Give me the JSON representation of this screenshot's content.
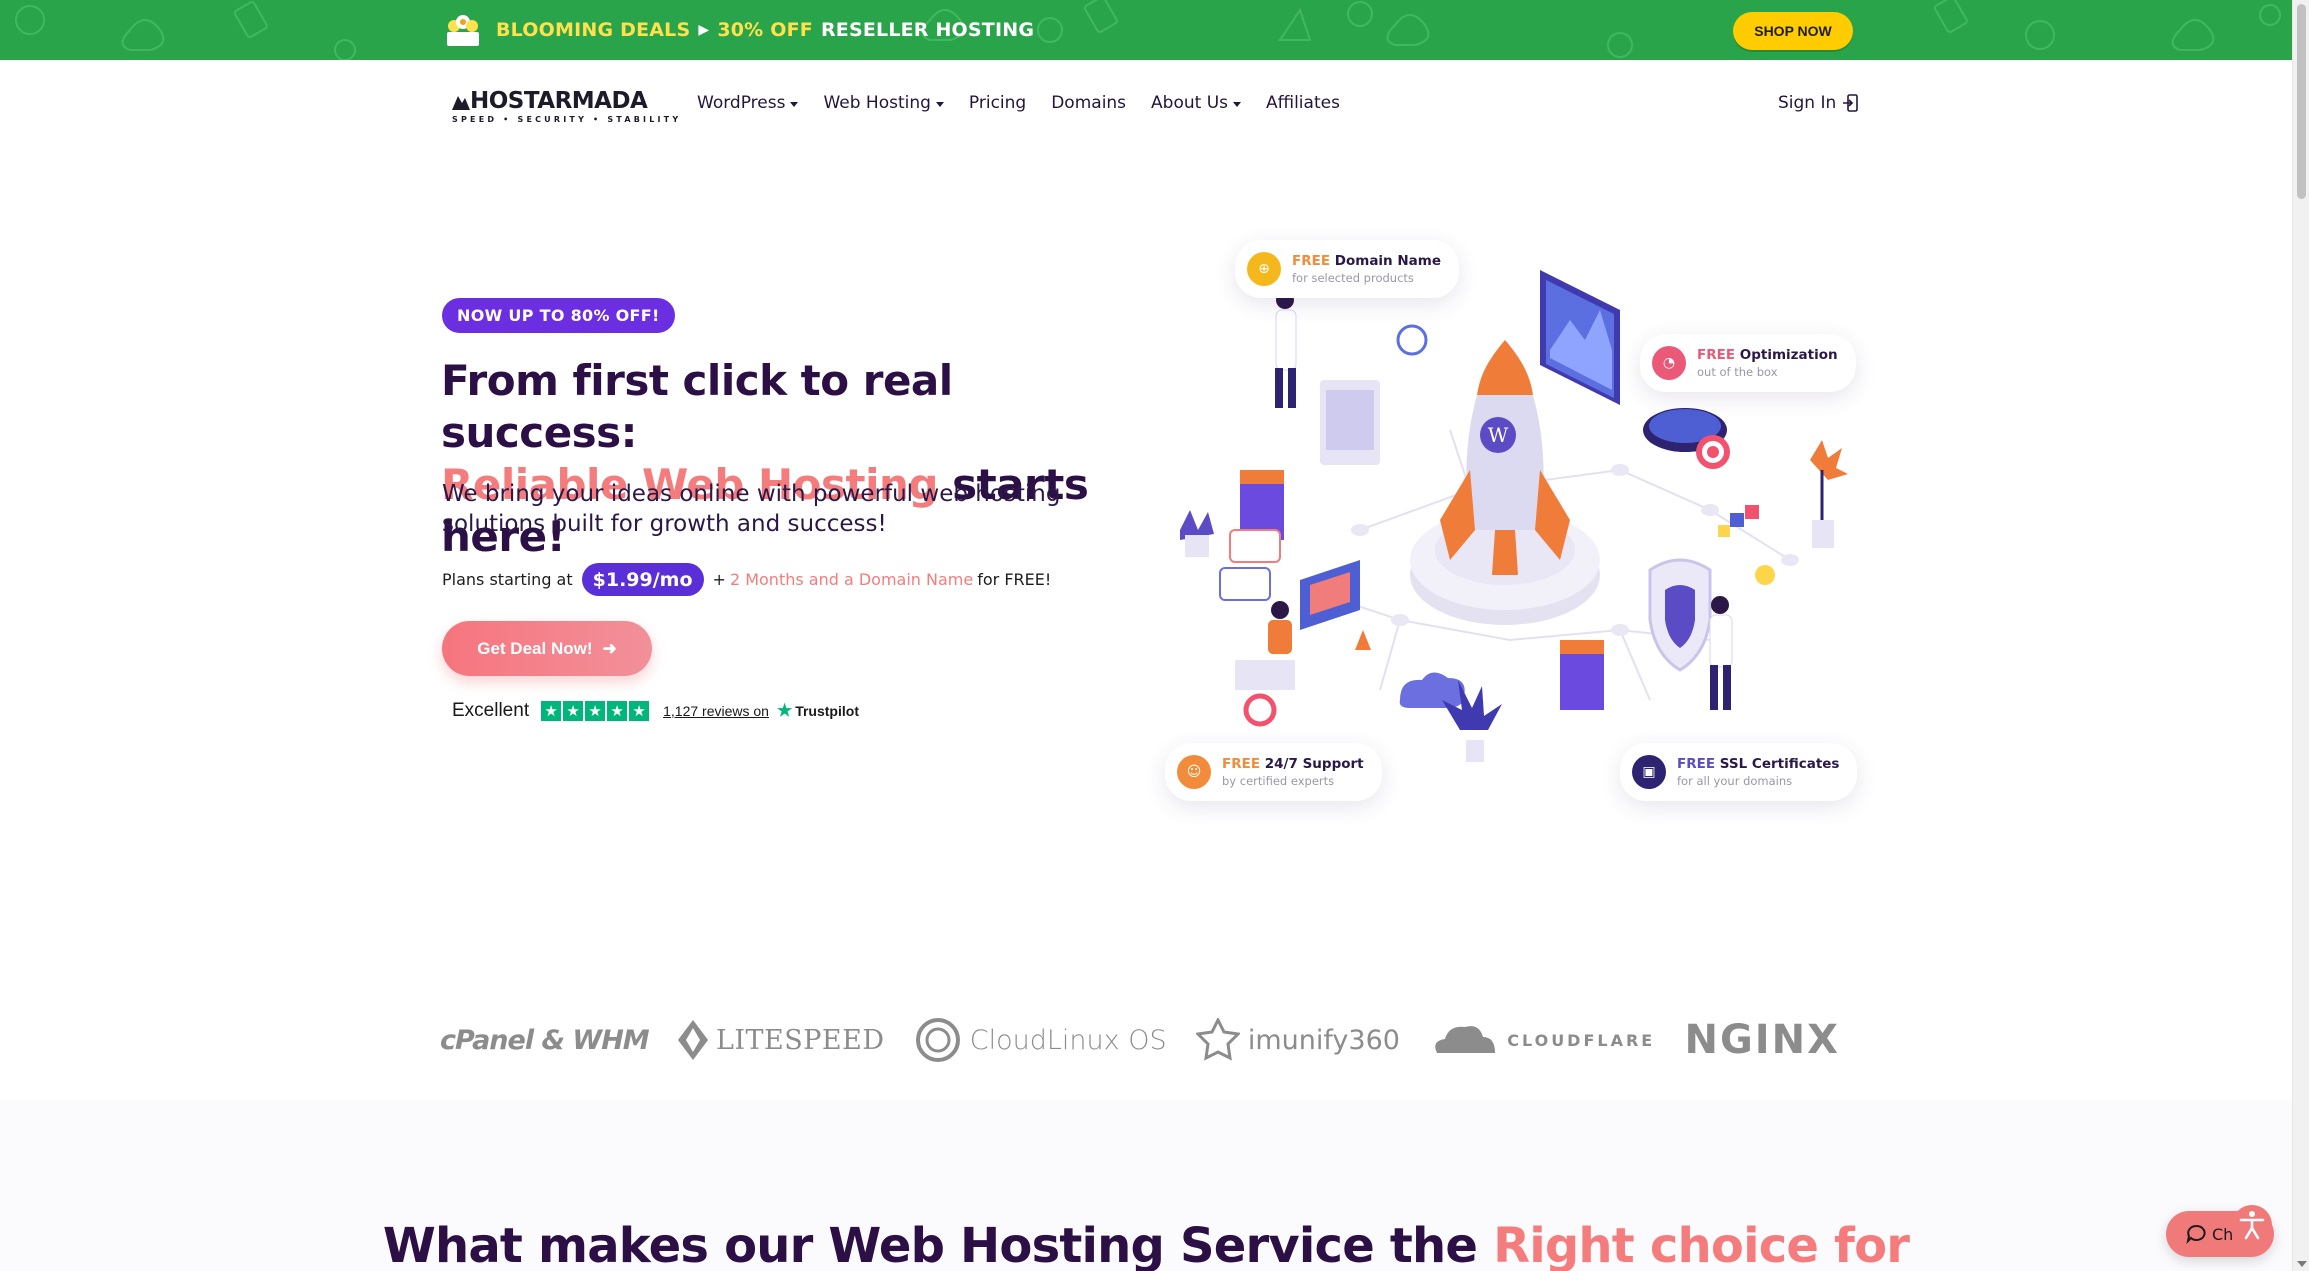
{
  "promo": {
    "deal_label": "BLOOMING DEALS",
    "discount": "30% OFF",
    "product": "RESELLER HOSTING",
    "shop_button": "SHOP NOW",
    "bg_color": "#2aa44a",
    "accent_color": "#ffe14d"
  },
  "nav": {
    "logo_text": "HOSTARMADA",
    "logo_tagline": "SPEED • SECURITY • STABILITY",
    "items": [
      {
        "label": "WordPress",
        "has_dropdown": true
      },
      {
        "label": "Web Hosting",
        "has_dropdown": true
      },
      {
        "label": "Pricing",
        "has_dropdown": false
      },
      {
        "label": "Domains",
        "has_dropdown": false
      },
      {
        "label": "About Us",
        "has_dropdown": true
      },
      {
        "label": "Affiliates",
        "has_dropdown": false
      }
    ],
    "sign_in": "Sign In"
  },
  "hero": {
    "badge": "NOW UP TO 80% OFF!",
    "headline_line1": "From first click to real success:",
    "headline_accent": "Reliable Web Hosting",
    "headline_rest": " starts here!",
    "subtitle": "We bring your ideas online with powerful web hosting solutions built for growth and success!",
    "plans_prefix": "Plans starting at",
    "price": "$1.99/mo",
    "plus": "+",
    "bonus": "2 Months and a Domain Name",
    "bonus_suffix": "for FREE!",
    "cta": "Get Deal Now!",
    "trustpilot": {
      "rating_word": "Excellent",
      "stars": 5,
      "reviews_text": "1,127 reviews on",
      "brand": "Trustpilot"
    }
  },
  "features": [
    {
      "free": "FREE",
      "title": "Domain Name",
      "sub": "for selected products",
      "icon": "globe-icon",
      "color": "#f5b81c"
    },
    {
      "free": "FREE",
      "title": "Optimization",
      "sub": "out of the box",
      "icon": "speedometer-icon",
      "color": "#ea5a78"
    },
    {
      "free": "FREE",
      "title": "24/7 Support",
      "sub": "by certified experts",
      "icon": "support-icon",
      "color": "#f28c3a"
    },
    {
      "free": "FREE",
      "title": "SSL Certificates",
      "sub": "for all your domains",
      "icon": "certificate-icon",
      "color": "#2d2370"
    }
  ],
  "tech_logos": {
    "cpanel": "cPanel & WHM",
    "litespeed": "LITESPEED",
    "cloudlinux": "CloudLinux OS",
    "imunify": "imunify360",
    "cloudflare": "CLOUDFLARE",
    "nginx": "NGINX"
  },
  "section": {
    "title_main": "What makes our Web Hosting Service the ",
    "title_accent": "Right choice for"
  },
  "chat": {
    "label": "Ch"
  }
}
